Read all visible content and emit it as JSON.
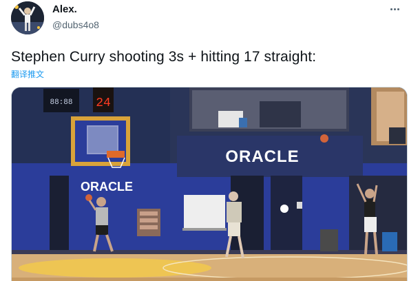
{
  "user": {
    "display_name": "Alex.",
    "handle": "@dubs4o8"
  },
  "tweet": {
    "text": "Stephen Curry shooting 3s + hitting 17 straight:",
    "translate_label": "翻译推文"
  },
  "media": {
    "wall_sign": "ORACLE",
    "baseline_sign": "ORACLE",
    "shot_clock": "24",
    "scoreboard": "88:88"
  },
  "icons": {
    "avatar": "avatar-icon",
    "more": "more-options-icon"
  },
  "colors": {
    "court_blue": "#2b3d9a",
    "floor_wood": "#d8b07a",
    "link": "#1d9bf0"
  }
}
